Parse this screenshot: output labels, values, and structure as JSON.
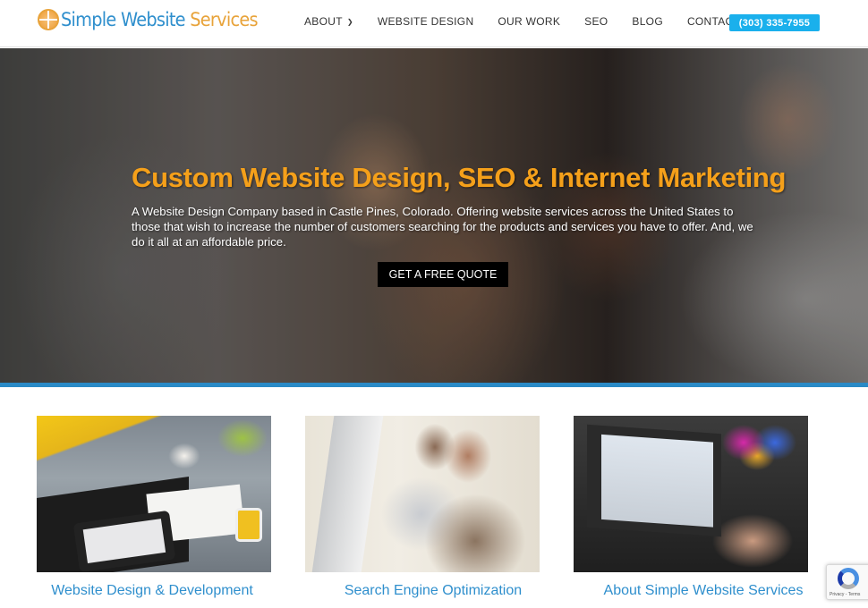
{
  "header": {
    "logo": {
      "part1": "Simple Website",
      "part2": " Services",
      "icon": "globe-icon"
    },
    "nav": [
      {
        "label": "ABOUT",
        "has_dropdown": true
      },
      {
        "label": "WEBSITE DESIGN"
      },
      {
        "label": "OUR WORK"
      },
      {
        "label": "SEO"
      },
      {
        "label": "BLOG"
      },
      {
        "label": "CONTACT"
      }
    ],
    "phone_button": "(303) 335-7955",
    "dropdown_icon": "chevron-down-icon"
  },
  "hero": {
    "title": "Custom Website Design, SEO & Internet Marketing",
    "description": "A Website Design Company based in Castle Pines, Colorado. Offering website services across the United States to those that wish to increase the number of customers searching for the products and services you have to offer. And, we do it all at an affordable price.",
    "cta_label": "GET A FREE QUOTE"
  },
  "cards": [
    {
      "title": "Website Design & Development",
      "image": "laptop-tablet-wireframe-photo"
    },
    {
      "title": "Search Engine Optimization",
      "image": "people-at-monitor-photo"
    },
    {
      "title": "About Simple Website Services",
      "image": "hands-typing-laptop-photo"
    }
  ],
  "recaptcha": {
    "label": "Privacy - Terms"
  },
  "colors": {
    "brand_blue": "#2f8fcd",
    "brand_orange": "#e8a33a",
    "hero_title": "#f5a01a",
    "phone_button": "#1ab0ec",
    "accent_bar": "#2a8ac6"
  }
}
